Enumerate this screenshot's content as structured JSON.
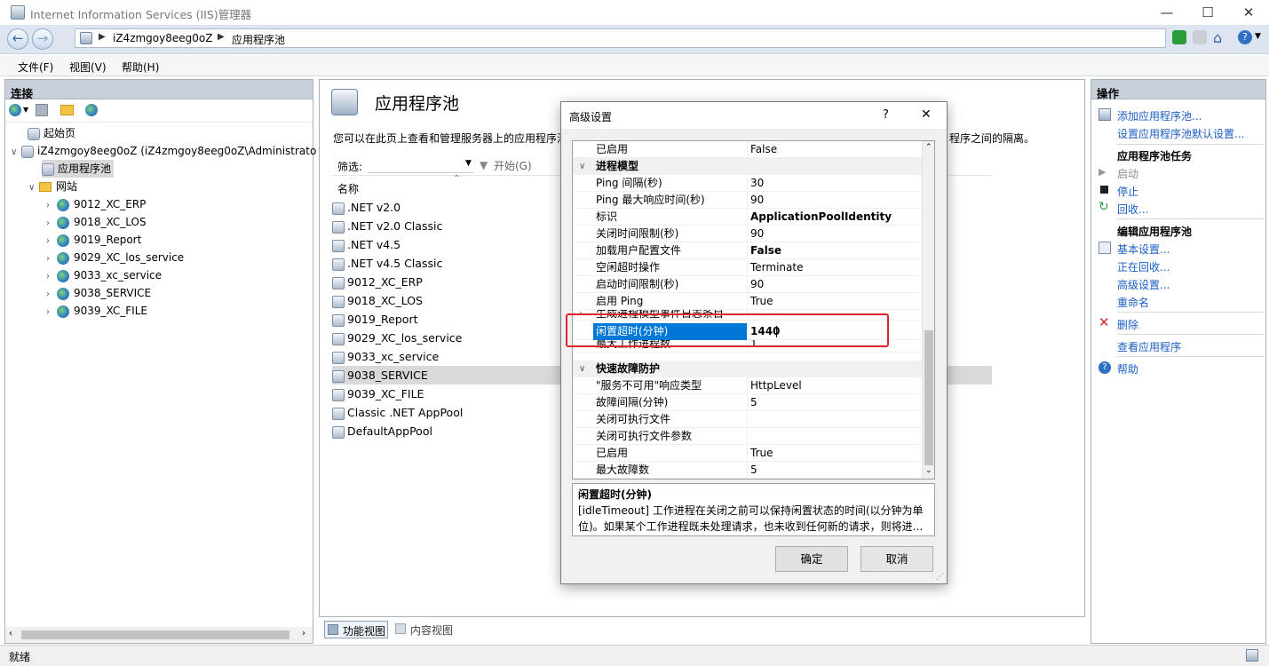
{
  "window": {
    "title": "Internet Information Services (IIS)管理器",
    "controls": {
      "minimize": "—",
      "maximize": "☐",
      "close": "✕"
    }
  },
  "address": {
    "segments": [
      "iZ4zmgoy8eeg0oZ",
      "应用程序池"
    ]
  },
  "menubar": {
    "items": [
      "文件(F)",
      "视图(V)",
      "帮助(H)"
    ]
  },
  "connections": {
    "header": "连接",
    "tree": [
      {
        "label": "起始页",
        "icon": "start-page-icon"
      },
      {
        "label": "iZ4zmgoy8eeg0oZ (iZ4zmgoy8eeg0oZ\\Administrato",
        "icon": "server-icon"
      },
      {
        "label": "应用程序池",
        "icon": "app-pool-icon",
        "selected": true
      },
      {
        "label": "网站",
        "icon": "sites-folder-icon"
      },
      {
        "label": "9012_XC_ERP",
        "icon": "site-globe-icon"
      },
      {
        "label": "9018_XC_LOS",
        "icon": "site-globe-icon"
      },
      {
        "label": "9019_Report",
        "icon": "site-globe-icon"
      },
      {
        "label": "9029_XC_los_service",
        "icon": "site-globe-icon"
      },
      {
        "label": "9033_xc_service",
        "icon": "site-globe-icon"
      },
      {
        "label": "9038_SERVICE",
        "icon": "site-globe-icon"
      },
      {
        "label": "9039_XC_FILE",
        "icon": "site-globe-icon"
      }
    ]
  },
  "main": {
    "title": "应用程序池",
    "description": "您可以在此页上查看和管理服务器上的应用程序池",
    "description_tail": "程序之间的隔离。",
    "filter_label": "筛选:",
    "start_label": "开始(G)",
    "column_name": "名称",
    "pools": [
      ".NET v2.0",
      ".NET v2.0 Classic",
      ".NET v4.5",
      ".NET v4.5 Classic",
      "9012_XC_ERP",
      "9018_XC_LOS",
      "9019_Report",
      "9029_XC_los_service",
      "9033_xc_service",
      "9038_SERVICE",
      "9039_XC_FILE",
      "Classic .NET AppPool",
      "DefaultAppPool"
    ],
    "selected_pool": "9038_SERVICE",
    "view_tabs": [
      "功能视图",
      "内容视图"
    ]
  },
  "actions": {
    "header": "操作",
    "items": [
      {
        "label": "添加应用程序池...",
        "type": "link",
        "icon": "add-pool-icon"
      },
      {
        "label": "设置应用程序池默认设置...",
        "type": "link"
      },
      {
        "label": "应用程序池任务",
        "type": "heading"
      },
      {
        "label": "启动",
        "type": "disabled",
        "icon": "play-icon"
      },
      {
        "label": "停止",
        "type": "link",
        "icon": "stop-icon"
      },
      {
        "label": "回收...",
        "type": "link",
        "icon": "recycle-icon"
      },
      {
        "label": "编辑应用程序池",
        "type": "heading"
      },
      {
        "label": "基本设置...",
        "type": "link",
        "icon": "settings-icon"
      },
      {
        "label": "正在回收...",
        "type": "link"
      },
      {
        "label": "高级设置...",
        "type": "link"
      },
      {
        "label": "重命名",
        "type": "link"
      },
      {
        "label": "删除",
        "type": "link",
        "icon": "delete-icon"
      },
      {
        "label": "查看应用程序",
        "type": "link"
      },
      {
        "label": "帮助",
        "type": "link",
        "icon": "help-icon"
      }
    ]
  },
  "status": {
    "text": "就绪"
  },
  "dialog": {
    "title": "高级设置",
    "help": "?",
    "close": "✕",
    "rows": [
      {
        "kind": "prop",
        "key": "已启用",
        "value": "False"
      },
      {
        "kind": "cat",
        "key": "进程模型",
        "toggle": "∨"
      },
      {
        "kind": "prop",
        "key": "Ping 间隔(秒)",
        "value": "30"
      },
      {
        "kind": "prop",
        "key": "Ping 最大响应时间(秒)",
        "value": "90"
      },
      {
        "kind": "prop",
        "key": "标识",
        "value": "ApplicationPoolIdentity",
        "bold": true
      },
      {
        "kind": "prop",
        "key": "关闭时间限制(秒)",
        "value": "90"
      },
      {
        "kind": "prop",
        "key": "加载用户配置文件",
        "value": "False",
        "bold": true
      },
      {
        "kind": "prop",
        "key": "空闲超时操作",
        "value": "Terminate"
      },
      {
        "kind": "prop",
        "key": "启动时间限制(秒)",
        "value": "90"
      },
      {
        "kind": "prop",
        "key": "启用 Ping",
        "value": "True"
      },
      {
        "kind": "prop",
        "key": "生成进程模型事件日志条目",
        "value": "",
        "toggle": "›"
      },
      {
        "kind": "prop",
        "key": "闲置超时(分钟)",
        "value": "1440",
        "selected": true,
        "bold": true
      },
      {
        "kind": "prop",
        "key": "最大工作进程数",
        "value": "1"
      },
      {
        "kind": "cat",
        "key": "快速故障防护",
        "toggle": "∨"
      },
      {
        "kind": "prop",
        "key": "\"服务不可用\"响应类型",
        "value": "HttpLevel"
      },
      {
        "kind": "prop",
        "key": "故障间隔(分钟)",
        "value": "5"
      },
      {
        "kind": "prop",
        "key": "关闭可执行文件",
        "value": ""
      },
      {
        "kind": "prop",
        "key": "关闭可执行文件参数",
        "value": ""
      },
      {
        "kind": "prop",
        "key": "已启用",
        "value": "True"
      },
      {
        "kind": "prop",
        "key": "最大故障数",
        "value": "5"
      }
    ],
    "desc_title": "闲置超时(分钟)",
    "desc_text": "[idleTimeout] 工作进程在关闭之前可以保持闲置状态的时间(以分钟为单位)。如果某个工作进程既未处理请求，也未收到任何新的请求，则将进...",
    "ok": "确定",
    "cancel": "取消"
  },
  "colors": {
    "highlight": "#e0242a",
    "selection": "#0078d7",
    "link": "#1a5ec6"
  }
}
